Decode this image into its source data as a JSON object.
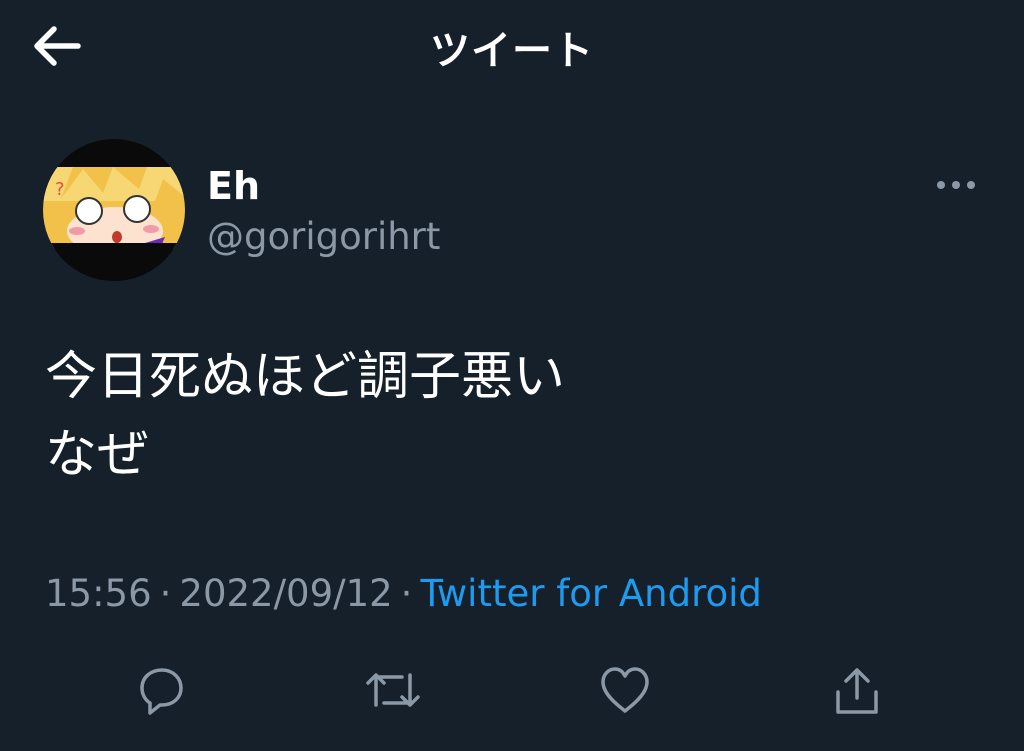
{
  "header": {
    "title": "ツイート",
    "back_icon": "arrow-left-icon"
  },
  "author": {
    "display_name": "Eh",
    "handle": "@gorigorihrt",
    "avatar_icon": "anime-avatar-icon"
  },
  "tweet": {
    "lines": [
      "今日死ぬほど調子悪い",
      "なぜ"
    ],
    "time": "15:56",
    "separator": "·",
    "date": "2022/09/12",
    "client": "Twitter for Android"
  },
  "actions": {
    "icons": [
      "reply-icon",
      "retweet-icon",
      "like-icon",
      "share-icon"
    ]
  },
  "colors": {
    "background": "#15202b",
    "text": "#ffffff",
    "secondary": "#8b98a5",
    "accent": "#1d9bf0"
  }
}
